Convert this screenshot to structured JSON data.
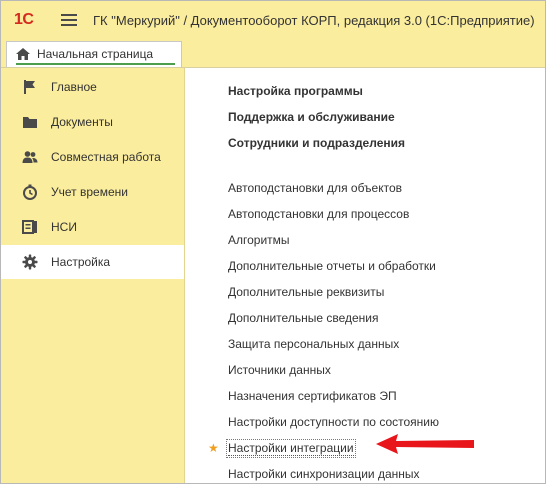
{
  "app": {
    "logo": "1С",
    "title": "ГК \"Меркурий\" / Документооборот КОРП, редакция 3.0  (1С:Предприятие)"
  },
  "tabs": [
    {
      "label": "Начальная страница"
    }
  ],
  "sidebar": {
    "items": [
      {
        "label": "Главное",
        "icon": "flag-icon"
      },
      {
        "label": "Документы",
        "icon": "folder-icon"
      },
      {
        "label": "Совместная работа",
        "icon": "users-icon"
      },
      {
        "label": "Учет времени",
        "icon": "clock-icon"
      },
      {
        "label": "НСИ",
        "icon": "reference-icon"
      },
      {
        "label": "Настройка",
        "icon": "gear-icon",
        "active": true
      }
    ]
  },
  "main": {
    "sections": [
      "Настройка программы",
      "Поддержка и обслуживание",
      "Сотрудники и подразделения"
    ],
    "links": [
      "Автоподстановки для объектов",
      "Автоподстановки для процессов",
      "Алгоритмы",
      "Дополнительные отчеты и обработки",
      "Дополнительные реквизиты",
      "Дополнительные сведения",
      "Защита персональных данных",
      "Источники данных",
      "Назначения сертификатов ЭП",
      "Настройки доступности по состоянию",
      "Настройки интеграции",
      "Настройки синхронизации данных"
    ],
    "highlighted_link": "Настройки интеграции"
  },
  "colors": {
    "panel_bg": "#fbed9e",
    "accent_green": "#4c9e4c",
    "logo_red": "#d42a1f",
    "arrow_red": "#e8151b",
    "star": "#f0a020"
  }
}
